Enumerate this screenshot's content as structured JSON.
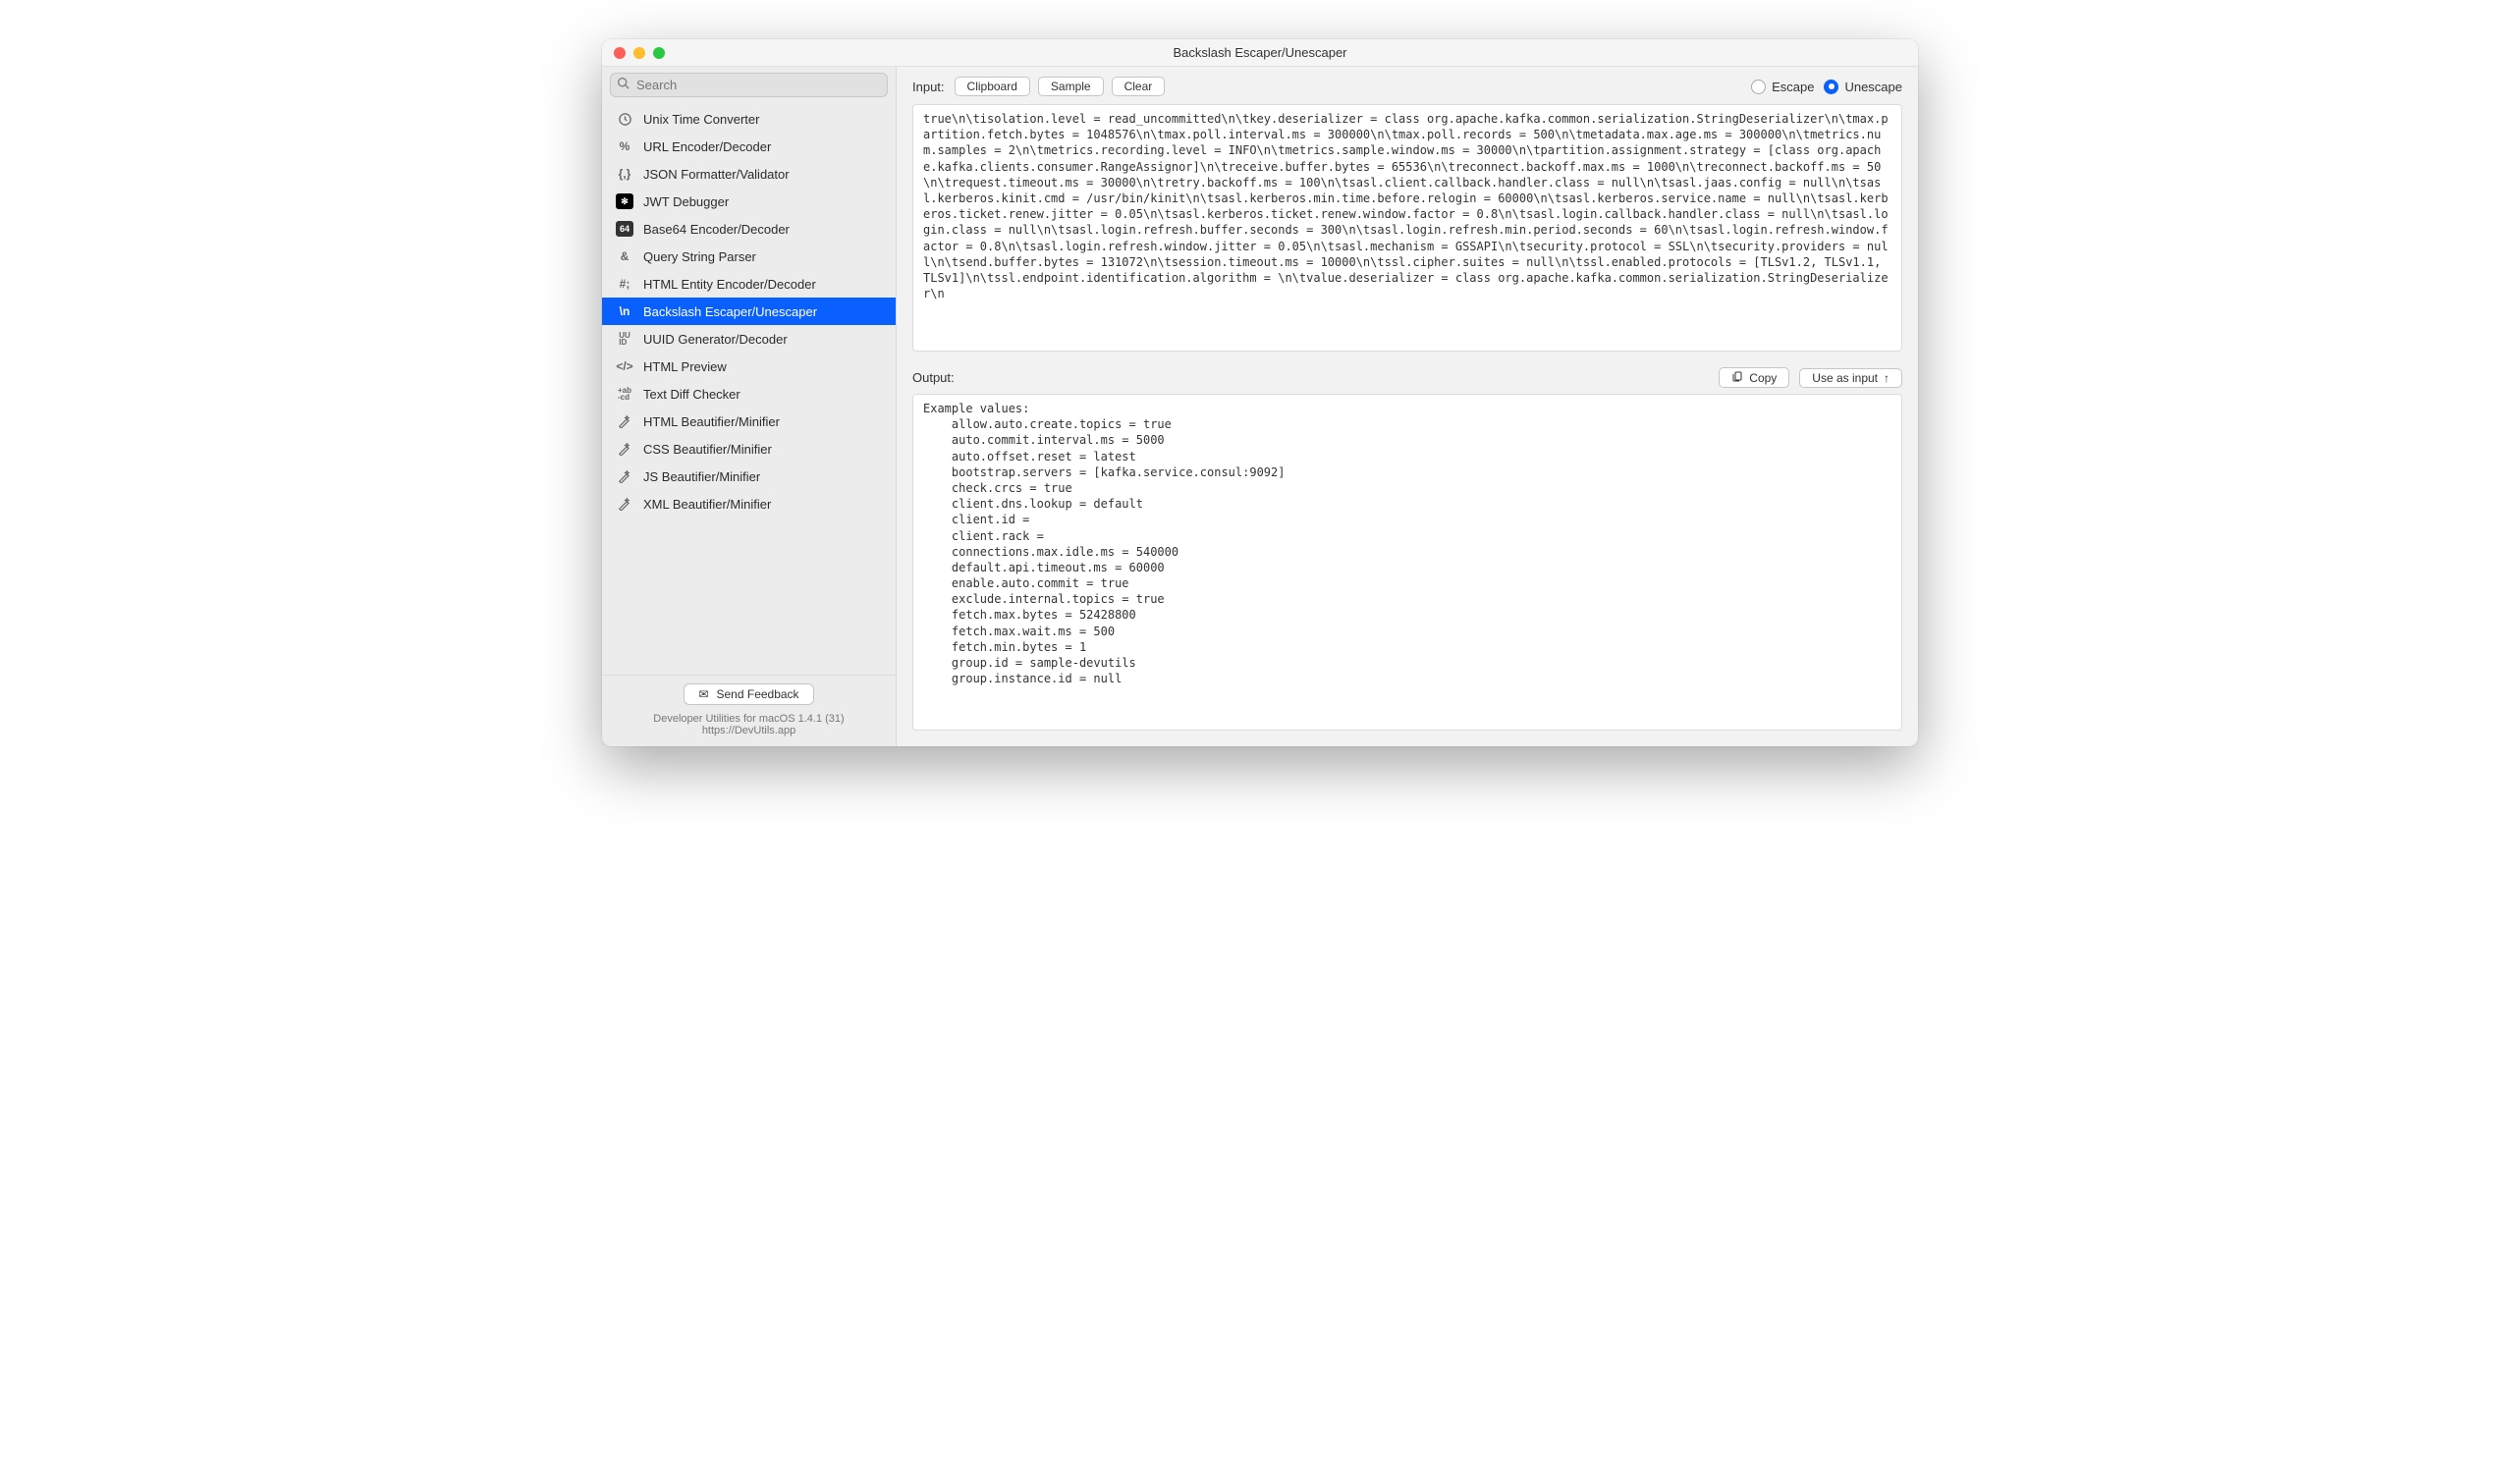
{
  "window": {
    "title": "Backslash Escaper/Unescaper"
  },
  "search": {
    "placeholder": "Search"
  },
  "sidebar": {
    "items": [
      {
        "label": "Unix Time Converter"
      },
      {
        "label": "URL Encoder/Decoder"
      },
      {
        "label": "JSON Formatter/Validator"
      },
      {
        "label": "JWT Debugger"
      },
      {
        "label": "Base64 Encoder/Decoder"
      },
      {
        "label": "Query String Parser"
      },
      {
        "label": "HTML Entity Encoder/Decoder"
      },
      {
        "label": "Backslash Escaper/Unescaper"
      },
      {
        "label": "UUID Generator/Decoder"
      },
      {
        "label": "HTML Preview"
      },
      {
        "label": "Text Diff Checker"
      },
      {
        "label": "HTML Beautifier/Minifier"
      },
      {
        "label": "CSS Beautifier/Minifier"
      },
      {
        "label": "JS Beautifier/Minifier"
      },
      {
        "label": "XML Beautifier/Minifier"
      }
    ],
    "footer": {
      "feedback": "Send Feedback",
      "line1": "Developer Utilities for macOS 1.4.1 (31)",
      "line2": "https://DevUtils.app"
    }
  },
  "toolbar": {
    "input_label": "Input:",
    "clipboard": "Clipboard",
    "sample": "Sample",
    "clear": "Clear",
    "escape": "Escape",
    "unescape": "Unescape"
  },
  "output": {
    "label": "Output:",
    "copy": "Copy",
    "use_as_input": "Use as input"
  },
  "text": {
    "input": "true\\n\\tisolation.level = read_uncommitted\\n\\tkey.deserializer = class org.apache.kafka.common.serialization.StringDeserializer\\n\\tmax.partition.fetch.bytes = 1048576\\n\\tmax.poll.interval.ms = 300000\\n\\tmax.poll.records = 500\\n\\tmetadata.max.age.ms = 300000\\n\\tmetrics.num.samples = 2\\n\\tmetrics.recording.level = INFO\\n\\tmetrics.sample.window.ms = 30000\\n\\tpartition.assignment.strategy = [class org.apache.kafka.clients.consumer.RangeAssignor]\\n\\treceive.buffer.bytes = 65536\\n\\treconnect.backoff.max.ms = 1000\\n\\treconnect.backoff.ms = 50\\n\\trequest.timeout.ms = 30000\\n\\tretry.backoff.ms = 100\\n\\tsasl.client.callback.handler.class = null\\n\\tsasl.jaas.config = null\\n\\tsasl.kerberos.kinit.cmd = /usr/bin/kinit\\n\\tsasl.kerberos.min.time.before.relogin = 60000\\n\\tsasl.kerberos.service.name = null\\n\\tsasl.kerberos.ticket.renew.jitter = 0.05\\n\\tsasl.kerberos.ticket.renew.window.factor = 0.8\\n\\tsasl.login.callback.handler.class = null\\n\\tsasl.login.class = null\\n\\tsasl.login.refresh.buffer.seconds = 300\\n\\tsasl.login.refresh.min.period.seconds = 60\\n\\tsasl.login.refresh.window.factor = 0.8\\n\\tsasl.login.refresh.window.jitter = 0.05\\n\\tsasl.mechanism = GSSAPI\\n\\tsecurity.protocol = SSL\\n\\tsecurity.providers = null\\n\\tsend.buffer.bytes = 131072\\n\\tsession.timeout.ms = 10000\\n\\tssl.cipher.suites = null\\n\\tssl.enabled.protocols = [TLSv1.2, TLSv1.1, TLSv1]\\n\\tssl.endpoint.identification.algorithm = \\n\\tvalue.deserializer = class org.apache.kafka.common.serialization.StringDeserializer\\n",
    "output": "Example values:\n    allow.auto.create.topics = true\n    auto.commit.interval.ms = 5000\n    auto.offset.reset = latest\n    bootstrap.servers = [kafka.service.consul:9092]\n    check.crcs = true\n    client.dns.lookup = default\n    client.id = \n    client.rack = \n    connections.max.idle.ms = 540000\n    default.api.timeout.ms = 60000\n    enable.auto.commit = true\n    exclude.internal.topics = true\n    fetch.max.bytes = 52428800\n    fetch.max.wait.ms = 500\n    fetch.min.bytes = 1\n    group.id = sample-devutils\n    group.instance.id = null"
  }
}
